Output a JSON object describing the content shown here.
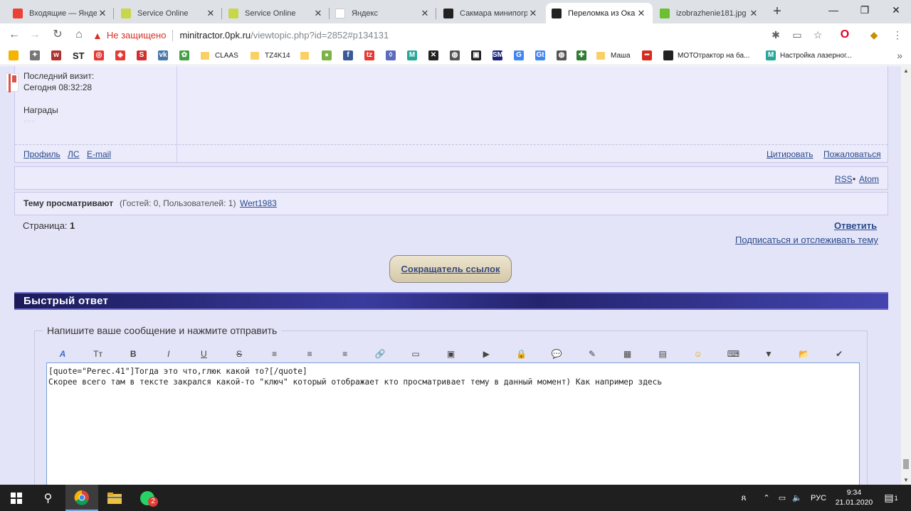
{
  "browser": {
    "tabs": [
      {
        "title": "Входящие — Яндекс",
        "icon": "mail-icon",
        "color": "#ea4335"
      },
      {
        "title": "Service Online",
        "icon": "service-icon",
        "color": "#c8d64a"
      },
      {
        "title": "Service Online",
        "icon": "service-icon",
        "color": "#c8d64a"
      },
      {
        "title": "Яндекс",
        "icon": "blank-icon",
        "color": "#ffffff"
      },
      {
        "title": "Сакмара минипогрузчик",
        "icon": "site-icon",
        "color": "#222222"
      },
      {
        "title": "Переломка из Ока",
        "icon": "site-icon",
        "color": "#222222",
        "active": true
      },
      {
        "title": "izobrazhenie181.jpg",
        "icon": "apple-icon",
        "color": "#6cbf2e"
      }
    ],
    "close_symbol": "✕",
    "new_tab_symbol": "+",
    "window_controls": {
      "minimize": "—",
      "maximize": "❐",
      "close": "✕"
    },
    "nav": {
      "back": "←",
      "forward": "→",
      "reload": "↻",
      "home": "⌂"
    },
    "security_warning": "Не защищено",
    "url_host": "minitractor.0pk.ru",
    "url_path": "/viewtopic.php?id=2852#p134131",
    "bookmarks": [
      {
        "label": "",
        "kind": "icon",
        "color": "#f4b400",
        "glyph": ""
      },
      {
        "label": "",
        "kind": "icon",
        "color": "#777777",
        "glyph": "✦"
      },
      {
        "label": "",
        "kind": "icon",
        "color": "#b03030",
        "glyph": "w"
      },
      {
        "label": "ST",
        "kind": "text"
      },
      {
        "label": "",
        "kind": "icon",
        "color": "#e53935",
        "glyph": "◎"
      },
      {
        "label": "",
        "kind": "icon",
        "color": "#e53935",
        "glyph": "◈"
      },
      {
        "label": "",
        "kind": "icon",
        "color": "#d32f2f",
        "glyph": "S"
      },
      {
        "label": "",
        "kind": "icon",
        "color": "#4a76a8",
        "glyph": "vk"
      },
      {
        "label": "",
        "kind": "icon",
        "color": "#43a047",
        "glyph": "✿"
      },
      {
        "label": "CLAAS",
        "kind": "folder"
      },
      {
        "label": "TZ4K14",
        "kind": "folder"
      },
      {
        "label": "",
        "kind": "folder"
      },
      {
        "label": "",
        "kind": "icon",
        "color": "#7cb342",
        "glyph": "●"
      },
      {
        "label": "",
        "kind": "icon",
        "color": "#3b5998",
        "glyph": "f"
      },
      {
        "label": "",
        "kind": "icon",
        "color": "#e53935",
        "glyph": "tz"
      },
      {
        "label": "",
        "kind": "icon",
        "color": "#5c6bc0",
        "glyph": "◊"
      },
      {
        "label": "",
        "kind": "icon",
        "color": "#26a69a",
        "glyph": "M"
      },
      {
        "label": "",
        "kind": "icon",
        "color": "#222222",
        "glyph": "✕"
      },
      {
        "label": "",
        "kind": "icon",
        "color": "#555555",
        "glyph": "◍"
      },
      {
        "label": "",
        "kind": "icon",
        "color": "#222222",
        "glyph": "▣"
      },
      {
        "label": "",
        "kind": "icon",
        "color": "#1a237e",
        "glyph": "SM"
      },
      {
        "label": "",
        "kind": "icon",
        "color": "#4285f4",
        "glyph": "G"
      },
      {
        "label": "",
        "kind": "icon",
        "color": "#4285f4",
        "glyph": "Gt"
      },
      {
        "label": "",
        "kind": "icon",
        "color": "#555555",
        "glyph": "◍"
      },
      {
        "label": "",
        "kind": "icon",
        "color": "#2e7d32",
        "glyph": "✚"
      },
      {
        "label": "Маша",
        "kind": "folder"
      },
      {
        "label": "",
        "kind": "icon",
        "color": "#d52b1e",
        "glyph": "━"
      },
      {
        "label": "МОТОтрактор на ба...",
        "kind": "site",
        "color": "#222222"
      },
      {
        "label": "Настройка лазерног...",
        "kind": "site",
        "color": "#26a69a",
        "glyph": "M"
      }
    ],
    "bookmarks_more": "»"
  },
  "post": {
    "last_visit_label": "Последний визит:",
    "last_visit_value": "Сегодня 08:32:28",
    "awards_label": "Награды",
    "profile_link": "Профиль",
    "pm_link": "ЛС",
    "email_link": "E-mail",
    "quote_link": "Цитировать",
    "report_link": "Пожаловаться"
  },
  "feeds": {
    "rss": "RSS",
    "separator": "•",
    "atom": "Atom"
  },
  "viewers": {
    "label": "Тему просматривают",
    "counts": "(Гостей: 0, Пользователей: 1)",
    "user": "Wert1983"
  },
  "pagination": {
    "label": "Страница:",
    "current": "1"
  },
  "actions": {
    "reply": "Ответить",
    "subscribe": "Подписаться и отслеживать тему"
  },
  "shortener_button": "Сокращатель ссылок",
  "quick_reply": {
    "title": "Быстрый ответ",
    "legend": "Напишите ваше сообщение и нажмите отправить",
    "tools": [
      {
        "name": "font-icon",
        "glyph": "A"
      },
      {
        "name": "size-icon",
        "glyph": "Tт"
      },
      {
        "name": "bold-icon",
        "glyph": "B"
      },
      {
        "name": "italic-icon",
        "glyph": "I"
      },
      {
        "name": "underline-icon",
        "glyph": "U"
      },
      {
        "name": "strike-icon",
        "glyph": "S"
      },
      {
        "name": "align-left-icon",
        "glyph": "≡"
      },
      {
        "name": "align-center-icon",
        "glyph": "≡"
      },
      {
        "name": "align-right-icon",
        "glyph": "≡"
      },
      {
        "name": "link-icon",
        "glyph": "🔗"
      },
      {
        "name": "image-icon",
        "glyph": "▭"
      },
      {
        "name": "gallery-icon",
        "glyph": "▣"
      },
      {
        "name": "video-icon",
        "glyph": "▶"
      },
      {
        "name": "hide-icon",
        "glyph": "🔒"
      },
      {
        "name": "quote-icon",
        "glyph": "💬"
      },
      {
        "name": "code-icon",
        "glyph": "✎"
      },
      {
        "name": "color-icon",
        "glyph": "▦"
      },
      {
        "name": "table-icon",
        "glyph": "▤"
      },
      {
        "name": "smiley-icon",
        "glyph": "☺"
      },
      {
        "name": "keyboard-icon",
        "glyph": "⌨"
      },
      {
        "name": "more-icon",
        "glyph": "▼"
      },
      {
        "name": "upload-icon",
        "glyph": "📂"
      },
      {
        "name": "spellcheck-icon",
        "glyph": "✔"
      }
    ],
    "message_line1": "[quote=\"Perec.41\"]Тогда это что,глюк какой то?[/quote]",
    "message_line2": "Скорее всего там в тексте закрался какой-то \"ключ\" который отображает кто просматривает тему в данный момент) Как например здесь"
  },
  "taskbar": {
    "language": "РУС",
    "time": "9:34",
    "date": "21.01.2020",
    "whatsapp_badge": "2",
    "notification_count": "1"
  }
}
